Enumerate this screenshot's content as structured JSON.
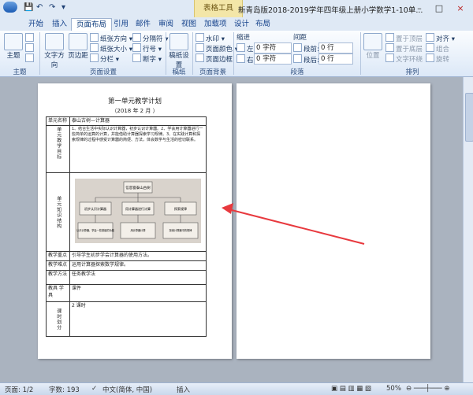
{
  "titlebar": {
    "doc_title": "新青岛版2018-2019学年四年级上册小学数学1-10单...",
    "context_tool": "表格工具",
    "min_label": "–",
    "max_label": "□",
    "close_label": "×"
  },
  "tabs": [
    "开始",
    "插入",
    "页面布局",
    "引用",
    "邮件",
    "审阅",
    "视图",
    "加载项",
    "设计",
    "布局"
  ],
  "ribbon": {
    "theme": {
      "label": "主题",
      "group": "主题"
    },
    "page_setup": {
      "group": "页面设置",
      "text_direction": "文字方向",
      "margins": "页边距",
      "orientation": "纸张方向",
      "size": "纸张大小",
      "columns": "分栏",
      "breaks": "分隔符",
      "line_numbers": "行号",
      "hyphenation": "断字"
    },
    "paper": {
      "group": "稿纸",
      "setting": "稿纸设置"
    },
    "background": {
      "group": "页面背景",
      "watermark": "水印",
      "page_color": "页面颜色",
      "page_border": "页面边框"
    },
    "paragraph": {
      "group": "段落",
      "indent": "缩进",
      "spacing": "间距",
      "left_label": "左:",
      "left_value": "0 字符",
      "right_label": "右:",
      "right_value": "0 字符",
      "before_label": "段前:",
      "before_value": "0 行",
      "after_label": "段后:",
      "after_value": "0 行"
    },
    "arrange": {
      "group": "排列",
      "position": "位置",
      "bring_front": "置于顶层",
      "send_back": "置于底层",
      "text_wrap": "文字环绕",
      "align": "对齐",
      "group_btn": "组合",
      "rotate": "旋转"
    }
  },
  "document": {
    "heading": "第一单元教学计划",
    "date": "（2018 年 2 月 ）",
    "rows": {
      "unit_name_label": "单元名称",
      "unit_name_value": "泰山古树—计算器",
      "goal_label": "单元教学目标",
      "goal_text": "1、结合生活中实际认识计算器，初步认识计算器。2、学会用计算器进行一些简单的运算的计算，并能借助计算器探索学习规律。3、在实践计算和探索规律的过程中感受计算器的简便、方法，体会数学与生活的密切联系。",
      "knowledge_label": "单元知识结构",
      "key_label": "教学重点",
      "key_text": "引导学生初步学会计算器的使用方法。",
      "difficulty_label": "教学难点",
      "difficulty_text": "运用计算器探索数学规律。",
      "method_label": "教学方法",
      "method_text": "任务教学法",
      "tools_label": "教具 学具",
      "tools_text": "课件",
      "hours_label": "课时划分",
      "hours_text": "2 课时"
    },
    "diagram": {
      "root": "信息窗泰山古树",
      "nodes": [
        "初步认识计算器",
        "用计算器进行计算",
        "探索规律"
      ],
      "leaves": [
        "认识计算器，学会一些按键的功能",
        "用计算器计算",
        "探索计算器中的规律"
      ]
    }
  },
  "statusbar": {
    "page": "页面: 1/2",
    "words": "字数: 193",
    "language": "中文(简体, 中国)",
    "mode": "插入",
    "zoom": "50%"
  },
  "colors": {
    "annotation_arrow": "#e8393e",
    "ribbon_blue": "#15428b",
    "context_tab": "#f3e6a8"
  }
}
